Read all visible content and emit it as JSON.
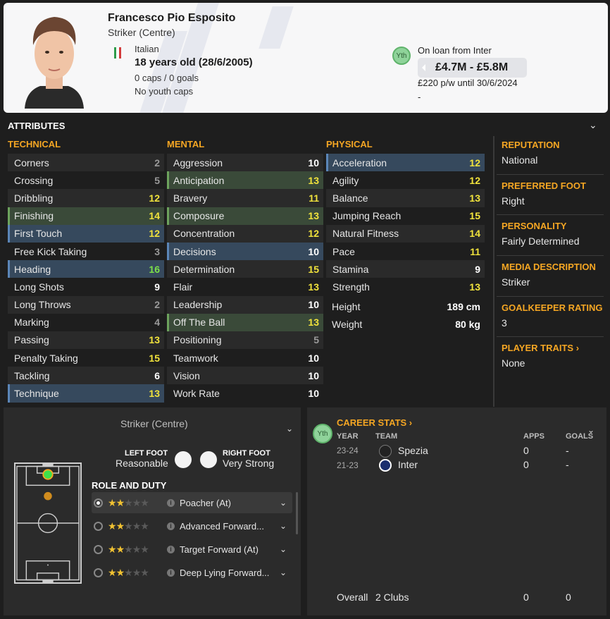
{
  "player": {
    "name": "Francesco Pio Esposito",
    "position": "Striker (Centre)",
    "nationality": "Italian",
    "age": "18 years old (28/6/2005)",
    "caps": "0 caps / 0 goals",
    "youth_caps": "No youth caps",
    "yth_badge": "Yth",
    "loan": "On loan from Inter",
    "value": "£4.7M - £5.8M",
    "wage": "£220 p/w until 30/6/2024",
    "wage_extra": "-"
  },
  "attributes": {
    "title": "ATTRIBUTES",
    "technical": {
      "title": "TECHNICAL",
      "items": [
        {
          "name": "Corners",
          "value": "2"
        },
        {
          "name": "Crossing",
          "value": "5"
        },
        {
          "name": "Dribbling",
          "value": "12"
        },
        {
          "name": "Finishing",
          "value": "14"
        },
        {
          "name": "First Touch",
          "value": "12"
        },
        {
          "name": "Free Kick Taking",
          "value": "3"
        },
        {
          "name": "Heading",
          "value": "16"
        },
        {
          "name": "Long Shots",
          "value": "9"
        },
        {
          "name": "Long Throws",
          "value": "2"
        },
        {
          "name": "Marking",
          "value": "4"
        },
        {
          "name": "Passing",
          "value": "13"
        },
        {
          "name": "Penalty Taking",
          "value": "15"
        },
        {
          "name": "Tackling",
          "value": "6"
        },
        {
          "name": "Technique",
          "value": "13"
        }
      ]
    },
    "mental": {
      "title": "MENTAL",
      "items": [
        {
          "name": "Aggression",
          "value": "10"
        },
        {
          "name": "Anticipation",
          "value": "13"
        },
        {
          "name": "Bravery",
          "value": "11"
        },
        {
          "name": "Composure",
          "value": "13"
        },
        {
          "name": "Concentration",
          "value": "12"
        },
        {
          "name": "Decisions",
          "value": "10"
        },
        {
          "name": "Determination",
          "value": "15"
        },
        {
          "name": "Flair",
          "value": "13"
        },
        {
          "name": "Leadership",
          "value": "10"
        },
        {
          "name": "Off The Ball",
          "value": "13"
        },
        {
          "name": "Positioning",
          "value": "5"
        },
        {
          "name": "Teamwork",
          "value": "10"
        },
        {
          "name": "Vision",
          "value": "10"
        },
        {
          "name": "Work Rate",
          "value": "10"
        }
      ]
    },
    "physical": {
      "title": "PHYSICAL",
      "items": [
        {
          "name": "Acceleration",
          "value": "12"
        },
        {
          "name": "Agility",
          "value": "12"
        },
        {
          "name": "Balance",
          "value": "13"
        },
        {
          "name": "Jumping Reach",
          "value": "15"
        },
        {
          "name": "Natural Fitness",
          "value": "14"
        },
        {
          "name": "Pace",
          "value": "11"
        },
        {
          "name": "Stamina",
          "value": "9"
        },
        {
          "name": "Strength",
          "value": "13"
        }
      ],
      "height_label": "Height",
      "height": "189 cm",
      "weight_label": "Weight",
      "weight": "80 kg"
    }
  },
  "info": {
    "reputation_label": "REPUTATION",
    "reputation": "National",
    "foot_label": "PREFERRED FOOT",
    "foot": "Right",
    "personality_label": "PERSONALITY",
    "personality": "Fairly Determined",
    "media_label": "MEDIA DESCRIPTION",
    "media": "Striker",
    "gk_label": "GOALKEEPER RATING",
    "gk": "3",
    "traits_label": "PLAYER TRAITS ›",
    "traits": "None"
  },
  "position_panel": {
    "title": "Striker (Centre)",
    "left_foot_label": "LEFT FOOT",
    "left_foot": "Reasonable",
    "right_foot_label": "RIGHT FOOT",
    "right_foot": "Very Strong",
    "role_title": "ROLE AND DUTY",
    "roles": [
      {
        "name": "Poacher (At)",
        "stars": 1.5
      },
      {
        "name": "Advanced Forward...",
        "stars": 1.5
      },
      {
        "name": "Target Forward (At)",
        "stars": 1.5
      },
      {
        "name": "Deep Lying Forward...",
        "stars": 1.5
      }
    ]
  },
  "career": {
    "badge": "Yth",
    "title": "CAREER STATS ›",
    "head_year": "YEAR",
    "head_team": "TEAM",
    "head_apps": "APPS",
    "head_goals": "GOALS",
    "rows": [
      {
        "year": "23-24",
        "team": "Spezia",
        "apps": "0",
        "goals": "-"
      },
      {
        "year": "21-23",
        "team": "Inter",
        "apps": "0",
        "goals": "-"
      }
    ],
    "overall_label": "Overall",
    "overall_clubs": "2 Clubs",
    "overall_apps": "0",
    "overall_goals": "0"
  },
  "colors": {
    "accent": "#f5a623",
    "attr_green": "#7ce04a",
    "attr_yellow": "#f1e33c"
  }
}
